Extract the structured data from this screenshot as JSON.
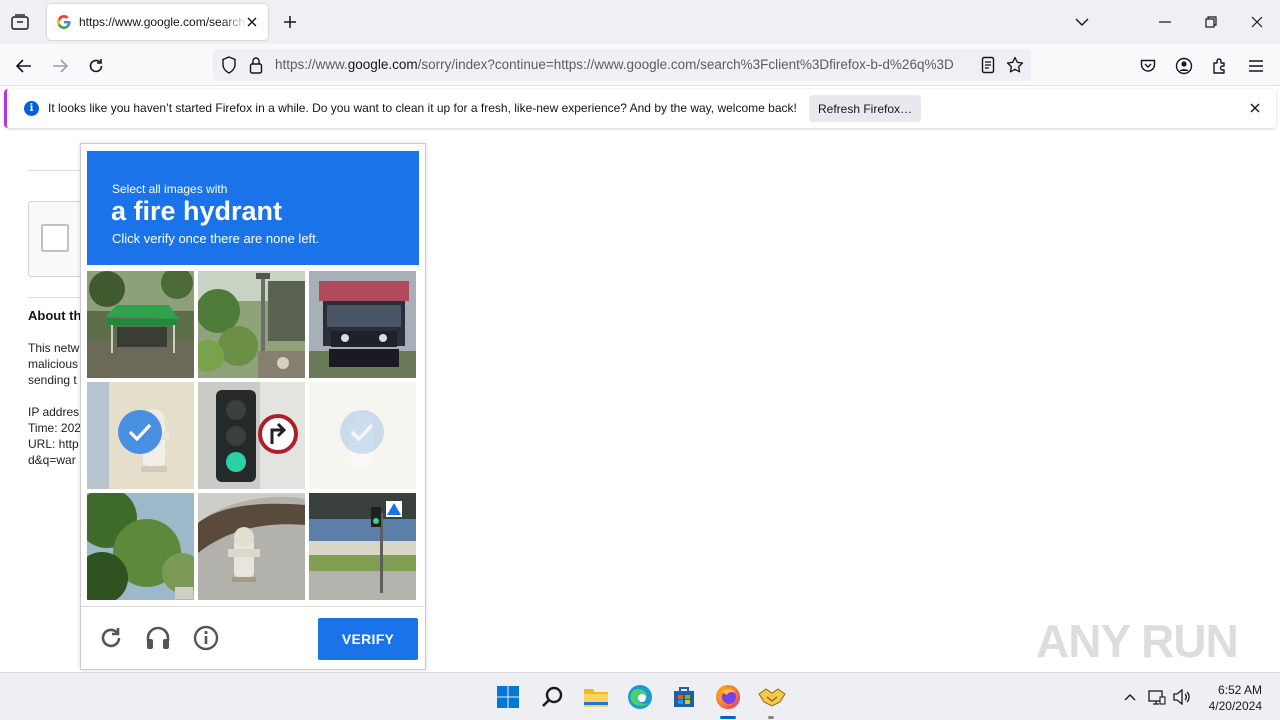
{
  "tab": {
    "title": "https://www.google.com/search?client=firefox-b-d&q"
  },
  "urlbar": {
    "url_prefix": "https://www.",
    "url_host": "google.com",
    "url_path": "/sorry/index?continue=https://www.google.com/search%3Fclient%3Dfirefox-b-d%26q%3D"
  },
  "notification": {
    "message": "It looks like you haven’t started Firefox in a while. Do you want to clean it up for a fresh, like-new experience? And by the way, welcome back!",
    "button": "Refresh Firefox…"
  },
  "page": {
    "about_heading": "About th",
    "lines": [
      "This netw",
      "malicious",
      "sending t",
      "",
      "IP addres",
      "Time: 202",
      "URL: http",
      "d&q=war"
    ]
  },
  "captcha": {
    "instruction_small": "Select all images with",
    "target": "a fire hydrant",
    "instruction_note": "Click verify once there are none left.",
    "tiles": [
      {
        "subject": "green canopy tent",
        "selected": false
      },
      {
        "subject": "street lamp and garden",
        "selected": false
      },
      {
        "subject": "truck front",
        "selected": false
      },
      {
        "subject": "fire hydrant",
        "selected": true
      },
      {
        "subject": "traffic light",
        "selected": false
      },
      {
        "subject": "fire hydrant",
        "selected": true,
        "fading": true
      },
      {
        "subject": "trees",
        "selected": false
      },
      {
        "subject": "fire hydrant",
        "selected": false
      },
      {
        "subject": "traffic light with crossing sign",
        "selected": false
      }
    ],
    "verify_label": "VERIFY"
  },
  "watermark": {
    "text": "ANY RUN"
  },
  "taskbar": {
    "time": "6:52 AM",
    "date": "4/20/2024"
  },
  "colors": {
    "captcha_blue": "#1a73e8",
    "firefox_accent": "#0060df"
  }
}
